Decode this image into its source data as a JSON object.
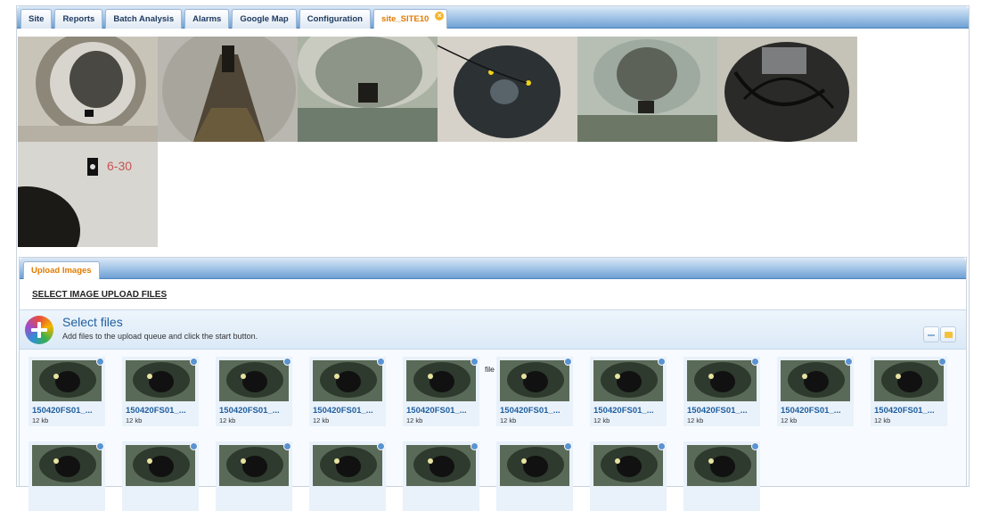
{
  "tabs": [
    {
      "label": "Site"
    },
    {
      "label": "Reports"
    },
    {
      "label": "Batch Analysis"
    },
    {
      "label": "Alarms"
    },
    {
      "label": "Google Map"
    },
    {
      "label": "Configuration"
    },
    {
      "label": "site_SITE10",
      "active": true
    }
  ],
  "close_icon": "close-icon",
  "gallery": {
    "photo_count": 7,
    "photo_6_label": "6-30"
  },
  "upload": {
    "tab_label": "Upload Images",
    "section_title": "SELECT IMAGE UPLOAD FILES",
    "title": "Select files",
    "subtitle": "Add files to the upload queue and click the start button.",
    "stray_text": "file",
    "files": [
      {
        "name": "150420FS01_...",
        "size": "12 kb"
      },
      {
        "name": "150420FS01_...",
        "size": "12 kb"
      },
      {
        "name": "150420FS01_...",
        "size": "12 kb"
      },
      {
        "name": "150420FS01_...",
        "size": "12 kb"
      },
      {
        "name": "150420FS01_...",
        "size": "12 kb"
      },
      {
        "name": "150420FS01_...",
        "size": "12 kb"
      },
      {
        "name": "150420FS01_...",
        "size": "12 kb"
      },
      {
        "name": "150420FS01_...",
        "size": "12 kb"
      },
      {
        "name": "150420FS01_...",
        "size": "12 kb"
      },
      {
        "name": "150420FS01_...",
        "size": "12 kb"
      },
      {
        "name": "",
        "size": ""
      },
      {
        "name": "",
        "size": ""
      },
      {
        "name": "",
        "size": ""
      },
      {
        "name": "",
        "size": ""
      },
      {
        "name": "",
        "size": ""
      },
      {
        "name": "",
        "size": ""
      },
      {
        "name": "",
        "size": ""
      },
      {
        "name": "",
        "size": ""
      }
    ]
  },
  "colors": {
    "tab_bar": "#6fa0d3",
    "active_tab_text": "#e07a00",
    "link_blue": "#1e5e9e"
  }
}
